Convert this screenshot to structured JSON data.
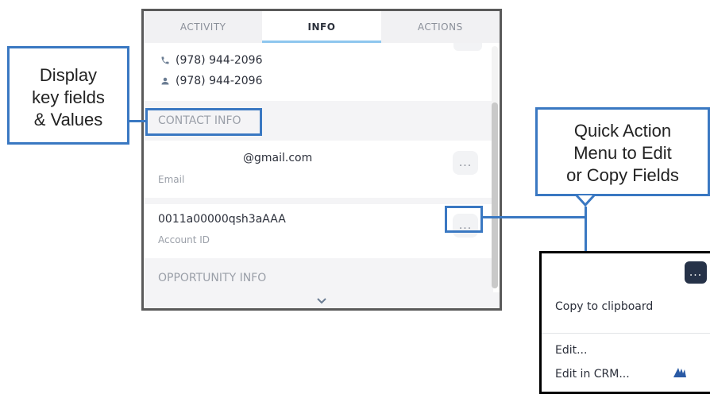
{
  "tabs": [
    "ACTIVITY",
    "INFO",
    "ACTIONS"
  ],
  "active_tab": "INFO",
  "phones": [
    {
      "icon": "phone-icon",
      "value": "(978) 944-2096"
    },
    {
      "icon": "person-icon",
      "value": "(978) 944-2096"
    }
  ],
  "sections": {
    "contact": "CONTACT INFO",
    "opportunity": "OPPORTUNITY INFO"
  },
  "fields": [
    {
      "value": "@gmail.com",
      "label": "Email"
    },
    {
      "value": "0011a00000qsh3aAAA",
      "label": "Account ID"
    }
  ],
  "more_button": "...",
  "footer_icon": "chevron-down-icon",
  "annotations": {
    "left": [
      "Display",
      "key fields",
      "& Values"
    ],
    "right": [
      "Quick Action",
      "Menu to Edit",
      "or Copy Fields"
    ]
  },
  "quick_menu": {
    "button": "...",
    "items": [
      "Copy to clipboard",
      "Edit...",
      "Edit in CRM..."
    ]
  },
  "colors": {
    "annotation": "#3a78c2",
    "active_tab_underline": "#8ec6ee",
    "quick_button": "#263248"
  }
}
